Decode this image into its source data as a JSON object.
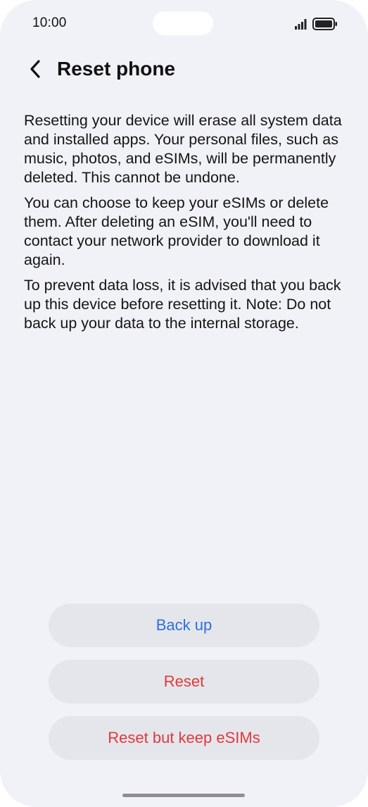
{
  "status_bar": {
    "time": "10:00",
    "icons": [
      "signal-icon",
      "battery-icon"
    ]
  },
  "header": {
    "back_icon": "chevron-left-icon",
    "title": "Reset phone"
  },
  "content": {
    "paragraphs": [
      "Resetting your device will erase all system data and installed apps. Your personal files, such as music, photos, and eSIMs, will be permanently deleted. This cannot be undone.",
      "You can choose to keep your eSIMs or delete them. After deleting an eSIM, you'll need to contact your network provider to download it again.",
      "To prevent data loss, it is advised that you back up this device before resetting it. Note: Do not back up your data to the internal storage."
    ]
  },
  "actions": {
    "backup_label": "Back up",
    "reset_label": "Reset",
    "reset_keep_label": "Reset but keep eSIMs"
  },
  "colors": {
    "background": "#f1f2f7",
    "button_bg": "#e5e6eb",
    "accent_blue": "#2f6fe0",
    "destructive_red": "#e5383b"
  }
}
